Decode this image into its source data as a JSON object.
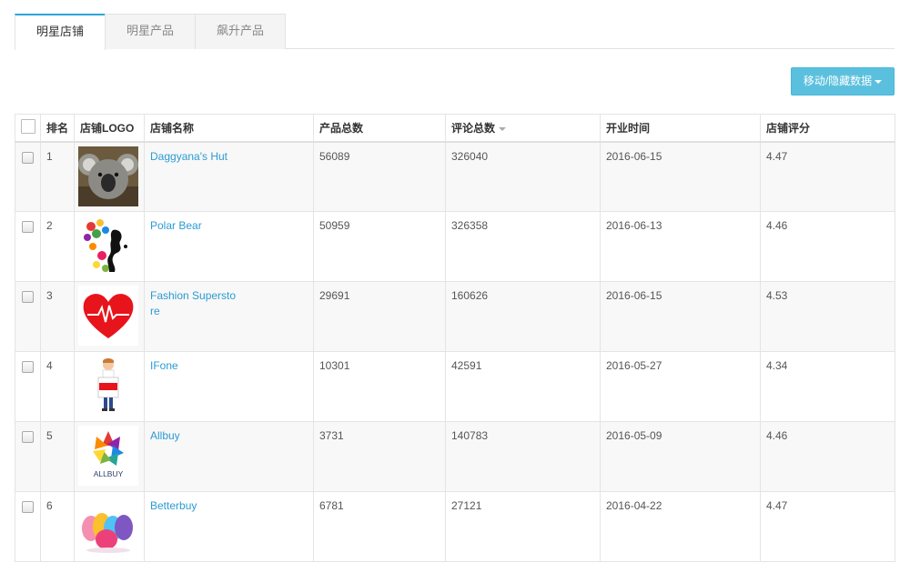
{
  "tabs": [
    {
      "label": "明星店铺",
      "active": true
    },
    {
      "label": "明星产品",
      "active": false
    },
    {
      "label": "飙升产品",
      "active": false
    }
  ],
  "move_button": {
    "label": "移动/隐藏数据"
  },
  "table": {
    "headers": {
      "rank": "排名",
      "logo": "店铺LOGO",
      "name": "店铺名称",
      "products": "产品总数",
      "reviews": "评论总数",
      "opened": "开业时间",
      "rating": "店铺评分"
    },
    "rows": [
      {
        "rank": "1",
        "logo": "koala-photo",
        "name": "Daggyana's Hut",
        "products": "56089",
        "reviews": "326040",
        "opened": "2016-06-15",
        "rating": "4.47"
      },
      {
        "rank": "2",
        "logo": "butterfly-woman-silhouette",
        "name": "Polar Bear",
        "products": "50959",
        "reviews": "326358",
        "opened": "2016-06-13",
        "rating": "4.46"
      },
      {
        "rank": "3",
        "logo": "red-heart-heartbeat",
        "name": "Fashion Superstore",
        "products": "29691",
        "reviews": "160626",
        "opened": "2016-06-15",
        "rating": "4.53"
      },
      {
        "rank": "4",
        "logo": "child-holding-sale-bag",
        "name": "IFone",
        "products": "10301",
        "reviews": "42591",
        "opened": "2016-05-27",
        "rating": "4.34"
      },
      {
        "rank": "5",
        "logo": "allbuy-logo",
        "logo_text": "ALLBUY",
        "name": "Allbuy",
        "products": "3731",
        "reviews": "140783",
        "opened": "2016-05-09",
        "rating": "4.46"
      },
      {
        "rank": "6",
        "logo": "makeup-sponges-photo",
        "name": "Betterbuy",
        "products": "6781",
        "reviews": "27121",
        "opened": "2016-04-22",
        "rating": "4.47"
      }
    ]
  },
  "colors": {
    "accent": "#2aa6d6",
    "button": "#5bc0de",
    "link": "#2b9bd3",
    "heart": "#e8141b"
  }
}
